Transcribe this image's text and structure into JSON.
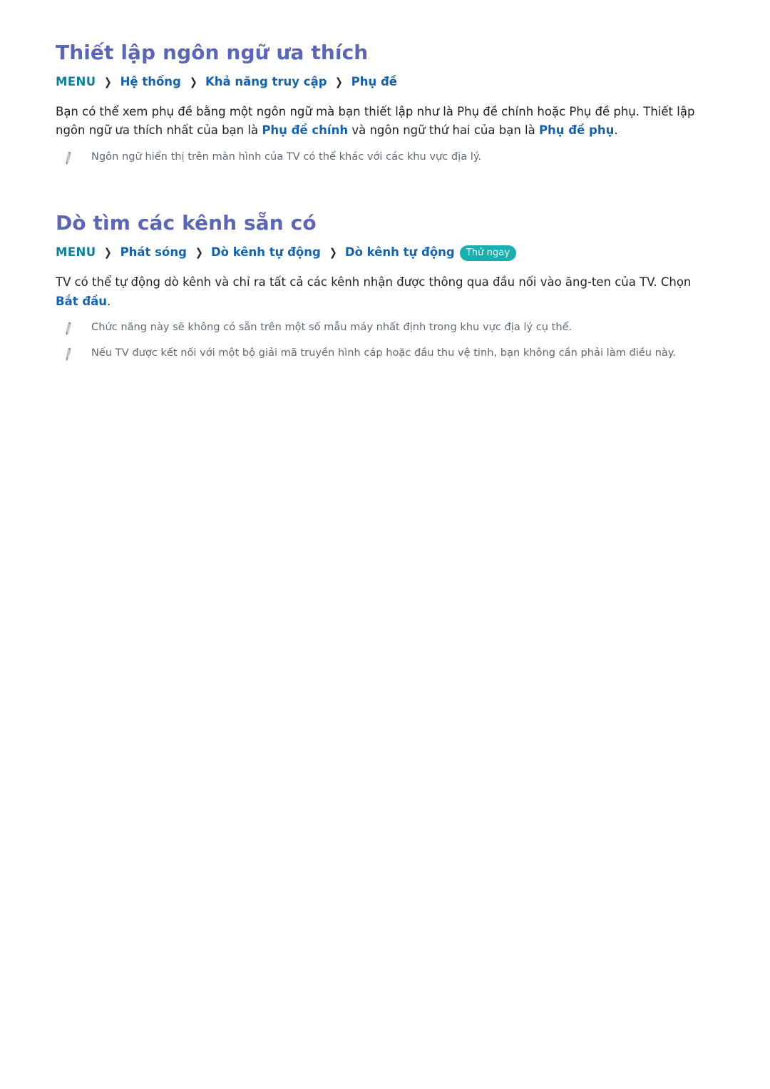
{
  "document": {
    "language": "vi",
    "colors": {
      "heading": "#5b66b5",
      "breadcrumb_root": "#0d7f9b",
      "breadcrumb_item": "#1463ac",
      "highlight": "#1463ac",
      "note_text": "#5f6a78",
      "badge_bg": "#18b0ae",
      "body_text": "#222222",
      "background": "#ffffff"
    }
  },
  "sections": [
    {
      "id": "preferred-language",
      "title": "Thiết lập ngôn ngữ ưa thích",
      "breadcrumb": {
        "root": "MENU",
        "separator": "❯",
        "items": [
          "Hệ thống",
          "Khả năng truy cập",
          "Phụ đề"
        ],
        "badge": null
      },
      "paragraph": {
        "part1": "Bạn có thể xem phụ đề bằng một ngôn ngữ mà bạn thiết lập như là Phụ đề chính hoặc Phụ đề phụ. Thiết lập ngôn ngữ ưa thích nhất của bạn là ",
        "highlight1": "Phụ đề chính",
        "part2": " và ngôn ngữ thứ hai của bạn là ",
        "highlight2": "Phụ đề phụ",
        "part3": "."
      },
      "notes": [
        {
          "icon": "pencil-icon",
          "text": "Ngôn ngữ hiển thị trên màn hình của TV có thể khác với các khu vực địa lý."
        }
      ]
    },
    {
      "id": "auto-channel-scan",
      "title": "Dò tìm các kênh sẵn có",
      "breadcrumb": {
        "root": "MENU",
        "separator": "❯",
        "items": [
          "Phát sóng",
          "Dò kênh tự động",
          "Dò kênh tự động"
        ],
        "badge": "Thử ngay"
      },
      "paragraph": {
        "part1": "TV có thể tự động dò kênh và chỉ ra tất cả các kênh nhận được thông qua đầu nối vào ăng-ten của TV. Chọn ",
        "highlight1": "Bắt đầu",
        "part2": ".",
        "highlight2": "",
        "part3": ""
      },
      "notes": [
        {
          "icon": "pencil-icon",
          "text": "Chức năng này sẽ không có sẵn trên một số mẫu máy nhất định trong khu vực địa lý cụ thể."
        },
        {
          "icon": "pencil-icon",
          "text": "Nếu TV được kết nối với một bộ giải mã truyền hình cáp hoặc đầu thu vệ tinh, bạn không cần phải làm điều này."
        }
      ]
    }
  ]
}
